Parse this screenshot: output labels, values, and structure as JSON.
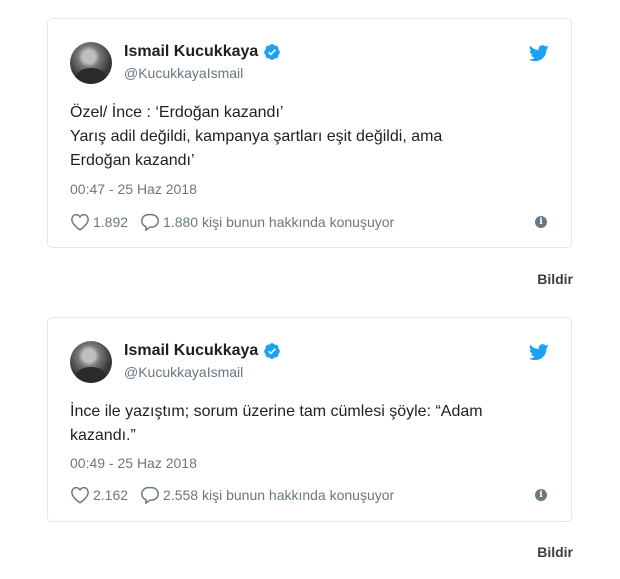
{
  "tweets": [
    {
      "author": "Ismail Kucukkaya",
      "handle": "@KucukkayaIsmail",
      "text_lines": [
        "Özel/ İnce : ‘Erdoğan kazandı’",
        "Yarış adil değildi, kampanya şartları eşit değildi, ama",
        "Erdoğan kazandı’"
      ],
      "timestamp": "00:47 - 25 Haz 2018",
      "likes": "1.892",
      "conversation": "1.880 kişi bunun hakkında konuşuyor",
      "report_label": "Bildir"
    },
    {
      "author": "Ismail Kucukkaya",
      "handle": "@KucukkayaIsmail",
      "text_lines": [
        "İnce ile yazıştım; sorum üzerine tam cümlesi şöyle: “Adam",
        "kazandı.”"
      ],
      "timestamp": "00:49 - 25 Haz 2018",
      "likes": "2.162",
      "conversation": "2.558 kişi bunun hakkında konuşuyor",
      "report_label": "Bildir"
    }
  ],
  "icons": {
    "verified": "verified-badge-icon",
    "brand": "twitter-bird-icon",
    "like": "heart-icon",
    "reply": "speech-bubble-icon",
    "info": "info-icon"
  },
  "colors": {
    "brand_blue": "#1da1f2",
    "muted_text": "#697882",
    "border": "#e1e8ed"
  }
}
